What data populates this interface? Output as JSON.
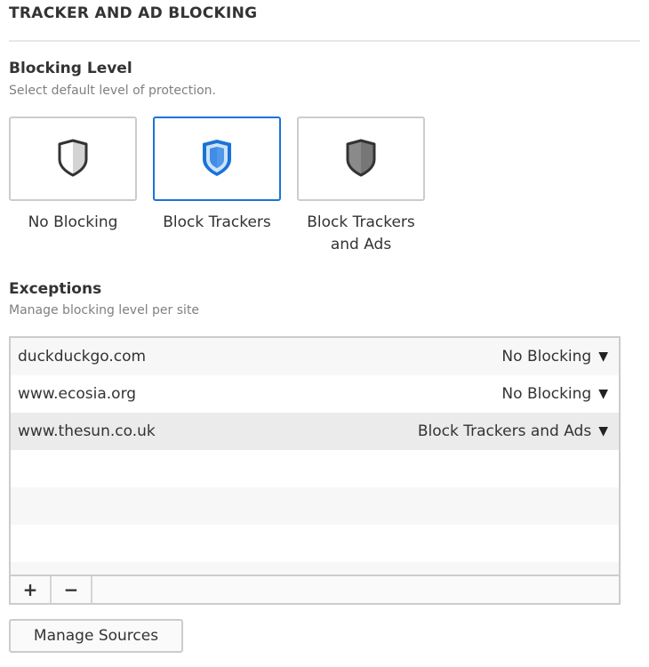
{
  "section": {
    "title": "TRACKER AND AD BLOCKING"
  },
  "blocking_level": {
    "title": "Blocking Level",
    "subtitle": "Select default level of protection.",
    "selected": "block-trackers",
    "options": [
      {
        "id": "no-blocking",
        "label": "No Blocking",
        "icon": "shield-half-icon"
      },
      {
        "id": "block-trackers",
        "label": "Block Trackers",
        "icon": "shield-blue-icon"
      },
      {
        "id": "block-trackers-ads",
        "label": "Block Trackers and Ads",
        "icon": "shield-dark-icon"
      }
    ]
  },
  "exceptions": {
    "title": "Exceptions",
    "subtitle": "Manage blocking level per site",
    "rows": [
      {
        "site": "duckduckgo.com",
        "level": "No Blocking"
      },
      {
        "site": "www.ecosia.org",
        "level": "No Blocking"
      },
      {
        "site": "www.thesun.co.uk",
        "level": "Block Trackers and Ads",
        "selected": true
      }
    ],
    "add_label": "+",
    "remove_label": "−"
  },
  "manage_sources_label": "Manage Sources",
  "colors": {
    "accent": "#1a73d9",
    "border": "#cccccc",
    "selected_row": "#ebebeb"
  }
}
